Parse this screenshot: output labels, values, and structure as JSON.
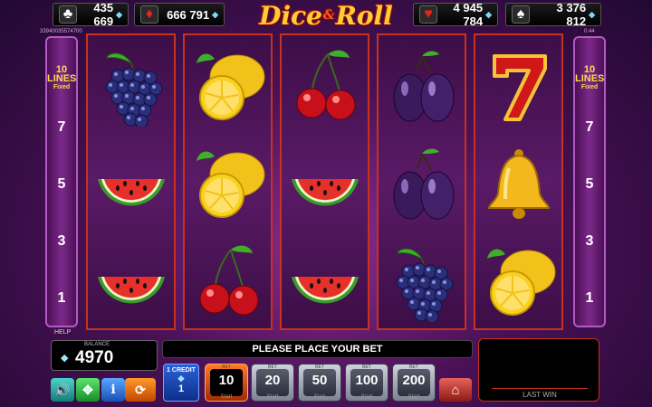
{
  "game": {
    "logo_word1": "Dice",
    "logo_amp": "&",
    "logo_word2": "Roll"
  },
  "jackpots": [
    {
      "suit": "clubs",
      "suit_glyph": "♣",
      "value": "435 669",
      "suit_color": "#ffffff"
    },
    {
      "suit": "diamonds",
      "suit_glyph": "♦",
      "value": "666 791",
      "suit_color": "#e8231a"
    },
    {
      "suit": "hearts",
      "suit_glyph": "♥",
      "value": "4 945 784",
      "suit_color": "#e8231a"
    },
    {
      "suit": "spades",
      "suit_glyph": "♠",
      "value": "3 376 812",
      "suit_color": "#ffffff"
    }
  ],
  "header_left_code": "33940035574700",
  "header_right_code": "0:44",
  "lines_panel": {
    "count": "10",
    "label": "LINES",
    "mode": "Fixed",
    "numbers": [
      "7",
      "5",
      "3",
      "1"
    ]
  },
  "reels": [
    [
      "grapes",
      "watermelon",
      "watermelon"
    ],
    [
      "lemon",
      "lemon",
      "cherries"
    ],
    [
      "cherries",
      "watermelon",
      "watermelon"
    ],
    [
      "plum",
      "plum",
      "grapes"
    ],
    [
      "seven",
      "bell",
      "lemon"
    ]
  ],
  "help_label": "HELP",
  "balance": {
    "label": "BALANCE",
    "value": "4970"
  },
  "message": "PLEASE PLACE YOUR BET",
  "last_win_label": "LAST WIN",
  "credit": {
    "label": "1 CREDIT",
    "value": "1"
  },
  "bet_label": "BET",
  "start_label": "Start",
  "bets": [
    {
      "value": "10",
      "active": true
    },
    {
      "value": "20",
      "active": false
    },
    {
      "value": "50",
      "active": false
    },
    {
      "value": "100",
      "active": false
    },
    {
      "value": "200",
      "active": false
    }
  ],
  "icons": {
    "sound": "speaker-icon",
    "fullscreen": "fullscreen-icon",
    "info": "info-icon",
    "autoplay": "autoplay-icon",
    "home": "home-icon",
    "gem": "diamond-gem-icon"
  },
  "colors": {
    "reel_border": "#c8321c",
    "accent_gold": "#ffd94a",
    "active_bet": "#ff7a2a"
  }
}
